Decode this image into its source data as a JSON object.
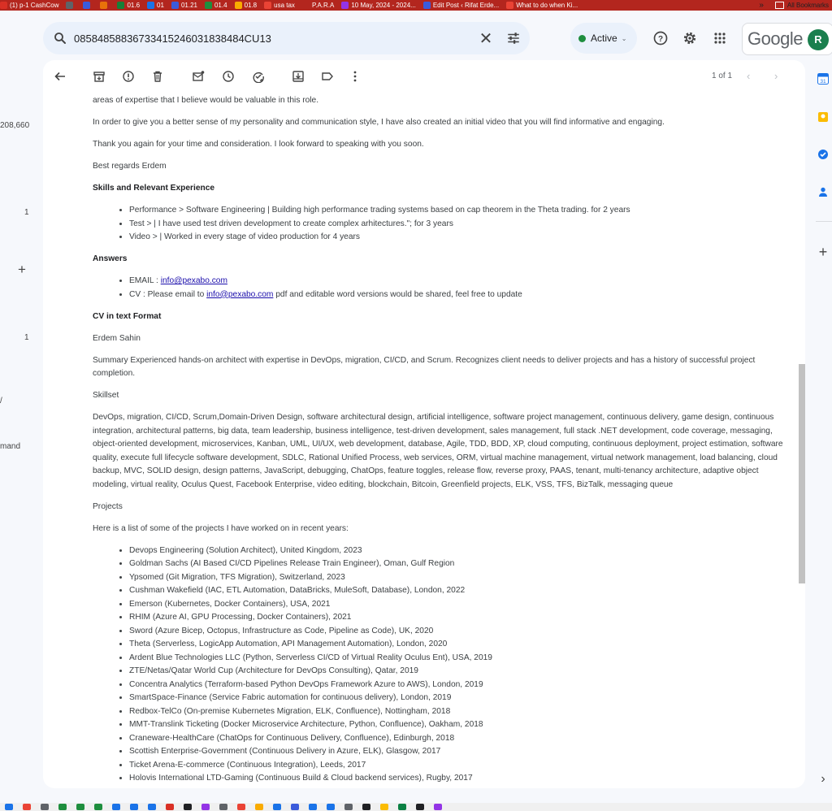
{
  "bookmarks": [
    {
      "label": "(1) p-1 CashCow",
      "color": "#d93025"
    },
    {
      "label": "",
      "color": "#5f6368"
    },
    {
      "label": "",
      "color": "#3b5bdb"
    },
    {
      "label": "",
      "color": "#e8710a"
    },
    {
      "label": "01.6",
      "color": "#188038"
    },
    {
      "label": "01",
      "color": "#1a73e8"
    },
    {
      "label": "01.21",
      "color": "#3b5bdb"
    },
    {
      "label": "01.4",
      "color": "#1e8e3e"
    },
    {
      "label": "01.8",
      "color": "#f9ab00"
    },
    {
      "label": "usa tax",
      "color": "#ea4335"
    },
    {
      "label": "P.A.R.A",
      "color": "#b3261e"
    },
    {
      "label": "10 May, 2024 - 2024...",
      "color": "#9334e6"
    },
    {
      "label": "Edit Post ‹ Rifat Erde...",
      "color": "#3b5bdb"
    },
    {
      "label": "What to do when Ki...",
      "color": "#ea4335"
    }
  ],
  "bookmarks_more": "»",
  "bookmarks_all": "All Bookmarks",
  "search": {
    "value": "0858485883673341524603183848​4CU13"
  },
  "status": {
    "label": "Active"
  },
  "brand": {
    "word": "Google",
    "avatar_letter": "R"
  },
  "sidebar_fragments": {
    "count_top": "208,660",
    "count_a": "1",
    "count_b": "1",
    "plus": "+",
    "slash": "/",
    "label": "mand"
  },
  "pager": {
    "text": "1 of 1"
  },
  "email": {
    "p_top": "areas of expertise that I believe would be valuable in this role.",
    "p_video": "In order to give you a better sense of my personality and communication style, I have also created an initial video that you will find informative and engaging.",
    "p_thanks": "Thank you again for your time and consideration. I look forward to speaking with you soon.",
    "p_regards": "Best regards Erdem",
    "h_skills": "Skills and Relevant Experience",
    "skills": [
      "Performance > Software Engineering | Building high performance trading systems based on cap theorem in the Theta trading. for 2 years",
      "Test > | I have used test driven development to create complex arhitectures.\"; for 3 years",
      "Video > | Worked in every stage of video production for 4 years"
    ],
    "h_answers": "Answers",
    "ans_email_prefix": "EMAIL : ",
    "ans_email_link": "info@pexabo.com",
    "ans_cv_prefix": "CV : Please email to ",
    "ans_cv_link": "info@pexabo.com",
    "ans_cv_suffix": " pdf and editable word versions would be shared, feel free to update",
    "h_cv": "CV in text Format",
    "p_name": "Erdem Sahin",
    "p_summary": "Summary Experienced hands-on architect with expertise in DevOps, migration, CI/CD, and Scrum. Recognizes client needs to deliver projects and has a history of successful project completion.",
    "p_skillset_title": "Skillset",
    "p_skillset": "DevOps, migration, CI/CD, Scrum,Domain-Driven Design, software architectural design, artificial intelligence, software project management, continuous delivery, game design, continuous integration, architectural patterns, big data, team leadership, business intelligence, test-driven development, sales management, full stack .NET development, code coverage, messaging, object-oriented development, microservices, Kanban, UML, UI/UX, web development, database, Agile, TDD, BDD, XP, cloud computing, continuous deployment, project estimation, software quality, execute full lifecycle software development, SDLC, Rational Unified Process, web services, ORM, virtual machine management, virtual network management, load balancing, cloud backup, MVC, SOLID design, design patterns, JavaScript, debugging, ChatOps, feature toggles, release flow, reverse proxy, PAAS, tenant, multi-tenancy architecture, adaptive object modeling, virtual reality, Oculus Quest, Facebook Enterprise, video editing, blockchain, Bitcoin, Greenfield projects, ELK, VSS, TFS, BizTalk, messaging queue",
    "p_projects_title": "Projects",
    "p_projects_intro": "Here is a list of some of the projects I have worked on in recent years:",
    "projects": [
      "Devops Engineering (Solution Architect), United Kingdom, 2023",
      "Goldman Sachs (AI Based CI/CD Pipelines Release Train Engineer), Oman, Gulf Region",
      "Ypsomed (Git Migration, TFS Migration), Switzerland, 2023",
      "Cushman Wakefield (IAC, ETL Automation, DataBricks, MuleSoft, Database), London, 2022",
      "Emerson (Kubernetes, Docker Containers), USA, 2021",
      "RHIM (Azure AI, GPU Processing, Docker Containers), 2021",
      "Sword (Azure Bicep, Octopus, Infrastructure as Code, Pipeline as Code), UK, 2020",
      "Theta (Serverless, LogicApp Automation, API Management Automation), London, 2020",
      "Ardent Blue Technologies LLC (Python, Serverless CI/CD of Virtual Reality Oculus Ent), USA, 2019",
      "ZTE/Netas/Qatar World Cup (Architecture for DevOps Consulting), Qatar, 2019",
      "Concentra Analytics (Terraform-based Python DevOps Framework Azure to AWS), London, 2019",
      "SmartSpace-Finance (Service Fabric automation for continuous delivery), London, 2019",
      "Redbox-TelCo (On-premise Kubernetes Migration, ELK, Confluence), Nottingham, 2018",
      "MMT-Translink Ticketing (Docker Microservice Architecture, Python, Confluence), Oakham, 2018",
      "Craneware-HealthCare (ChatOps for Continuous Delivery, Confluence), Edinburgh, 2018",
      "Scottish Enterprise-Government (Continuous Delivery in Azure, ELK), Glasgow, 2017",
      "Ticket Arena-E-commerce (Continuous Integration), Leeds, 2017",
      "Holovis International LTD-Gaming (Continuous Build & Cloud backend services), Rugby, 2017"
    ]
  },
  "rail_plus": "+",
  "rail_more": "›"
}
